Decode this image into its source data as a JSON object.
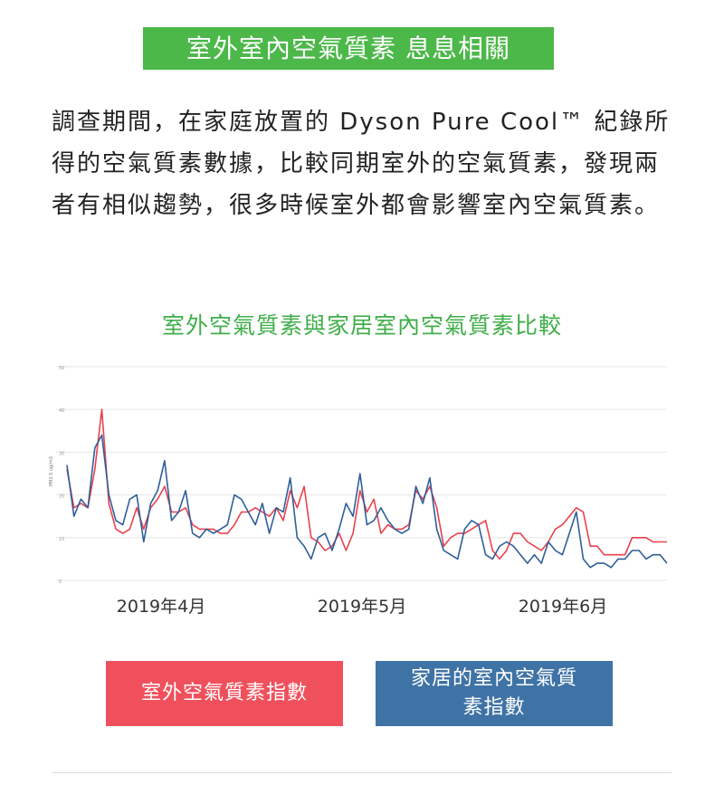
{
  "banner": {
    "text": "室外室內空氣質素 息息相關"
  },
  "intro": {
    "text": "調查期間，在家庭放置的 Dyson Pure Cool™ 紀錄所得的空氣質素數據，比較同期室外的空氣質素，發現兩者有相似趨勢，很多時候室外都會影響室內空氣質素。"
  },
  "chart_data": {
    "type": "line",
    "title": "室外空氣質素與家居室內空氣質素比較",
    "ylabel": "PM2.5 ug/m3",
    "ylim": [
      0,
      50
    ],
    "yticks": [
      0,
      10,
      20,
      30,
      40,
      50
    ],
    "xlabels": [
      "2019年4月",
      "2019年5月",
      "2019年6月"
    ],
    "grid": true,
    "series": [
      {
        "name": "室外空氣質素指數",
        "color": "#e8424f",
        "values": [
          26,
          17,
          18,
          17,
          26,
          40,
          18,
          12,
          11,
          12,
          17,
          12,
          17,
          19,
          22,
          16,
          16,
          17,
          13,
          12,
          12,
          12,
          11,
          11,
          13,
          16,
          16,
          17,
          16,
          15,
          17,
          14,
          21,
          17,
          22,
          10,
          9,
          7,
          8,
          11,
          7,
          11,
          21,
          16,
          19,
          11,
          13,
          12,
          12,
          13,
          21,
          19,
          22,
          17,
          8,
          10,
          11,
          11,
          12,
          13,
          14,
          7,
          5,
          7,
          11,
          11,
          9,
          8,
          7,
          9,
          12,
          13,
          15,
          17,
          16,
          8,
          8,
          6,
          6,
          6,
          6,
          10,
          10,
          10,
          9,
          9,
          9
        ]
      },
      {
        "name": "家居的室內空氣質素指數",
        "color": "#2f5f9a",
        "values": [
          27,
          15,
          19,
          17,
          31,
          34,
          20,
          14,
          13,
          19,
          20,
          9,
          18,
          21,
          28,
          14,
          16,
          21,
          11,
          10,
          12,
          11,
          12,
          13,
          20,
          19,
          16,
          13,
          18,
          11,
          17,
          16,
          24,
          10,
          8,
          5,
          10,
          11,
          7,
          12,
          18,
          15,
          25,
          13,
          14,
          17,
          14,
          12,
          11,
          12,
          22,
          18,
          24,
          12,
          7,
          6,
          5,
          12,
          14,
          13,
          6,
          5,
          8,
          9,
          8,
          6,
          4,
          6,
          4,
          9,
          7,
          6,
          11,
          16,
          5,
          3,
          4,
          4,
          3,
          5,
          5,
          7,
          7,
          5,
          6,
          6,
          4
        ]
      }
    ]
  },
  "legend": {
    "outdoor_label": "室外空氣質素指數",
    "indoor_label": "家居的室內空氣質素指數"
  }
}
